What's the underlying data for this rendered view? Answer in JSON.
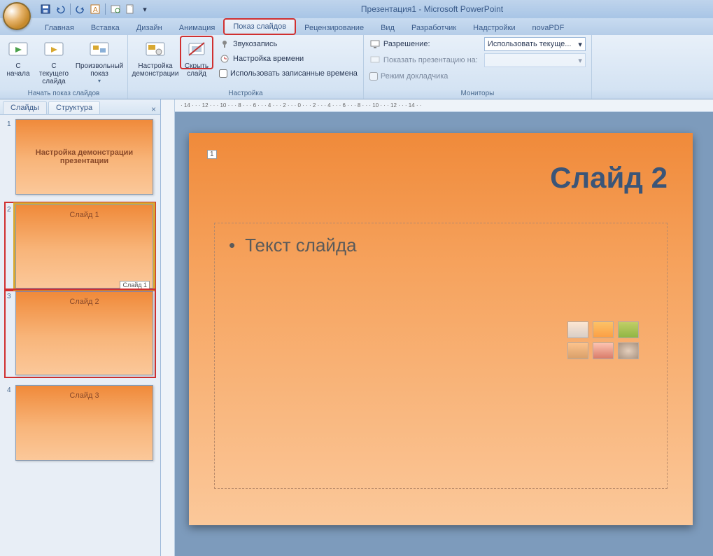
{
  "title": "Презентация1 - Microsoft PowerPoint",
  "qat": {
    "save": "save",
    "undo": "undo",
    "redo": "redo"
  },
  "tabs": {
    "home": "Главная",
    "insert": "Вставка",
    "design": "Дизайн",
    "animation": "Анимация",
    "slideshow": "Показ слайдов",
    "review": "Рецензирование",
    "view": "Вид",
    "developer": "Разработчик",
    "addins": "Надстройки",
    "novapdf": "novaPDF"
  },
  "ribbon": {
    "group_start": {
      "label": "Начать показ слайдов",
      "from_start_l1": "С",
      "from_start_l2": "начала",
      "from_current_l1": "С текущего",
      "from_current_l2": "слайда",
      "custom_l1": "Произвольный",
      "custom_l2": "показ"
    },
    "group_setup": {
      "label": "Настройка",
      "setup_l1": "Настройка",
      "setup_l2": "демонстрации",
      "hide_l1": "Скрыть",
      "hide_l2": "слайд",
      "record": "Звукозапись",
      "rehearse": "Настройка времени",
      "use_timings": "Использовать записанные времена"
    },
    "group_monitors": {
      "label": "Мониторы",
      "resolution_lbl": "Разрешение:",
      "resolution_val": "Использовать текуще...",
      "show_on": "Показать презентацию на:",
      "presenter": "Режим докладчика"
    }
  },
  "panel": {
    "slides_tab": "Слайды",
    "outline_tab": "Структура"
  },
  "thumbs": [
    {
      "num": "1",
      "title": "Настройка демонстрации презентации"
    },
    {
      "num": "2",
      "title": "Слайд 1",
      "badge": "Слайд 1"
    },
    {
      "num": "3",
      "title": "Слайд 2"
    },
    {
      "num": "4",
      "title": "Слайд 3"
    }
  ],
  "hruler": "· 14 · · · 12 · · · 10 · · · 8 · · · 6 · · · 4 · · · 2 · · · 0 · · · 2 · · · 4 · · · 6 · · · 8 · · · 10 · · · 12 · · · 14 · ·",
  "slide": {
    "page": "1",
    "title": "Слайд 2",
    "bullet": "Текст слайда"
  }
}
